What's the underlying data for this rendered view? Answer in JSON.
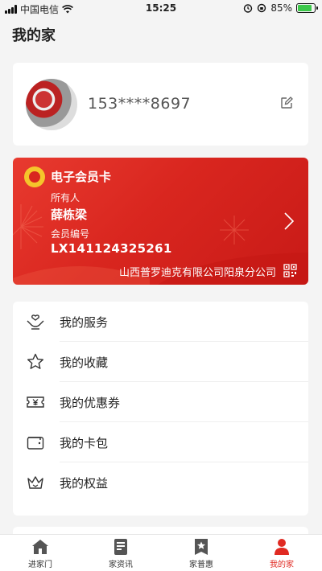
{
  "status_bar": {
    "carrier": "中国电信",
    "time": "15:25",
    "battery_percent": "85%",
    "battery_level": 0.85
  },
  "page": {
    "title": "我的家"
  },
  "profile": {
    "phone": "153****8697",
    "avatar_icon": "user-avatar-photo",
    "edit_icon": "edit-icon"
  },
  "member_card": {
    "title": "电子会员卡",
    "owner_label": "所有人",
    "owner_name": "薛栋梁",
    "number_label": "会员编号",
    "number": "LX141124325261",
    "company": "山西普罗迪克有限公司阳泉分公司",
    "card_color": "#d9261f",
    "logo_color": "#f5c52b"
  },
  "menu": {
    "items": [
      {
        "label": "我的服务",
        "icon": "service-hands-icon"
      },
      {
        "label": "我的收藏",
        "icon": "star-icon"
      },
      {
        "label": "我的优惠券",
        "icon": "coupon-icon"
      },
      {
        "label": "我的卡包",
        "icon": "wallet-icon"
      },
      {
        "label": "我的权益",
        "icon": "crown-icon"
      }
    ]
  },
  "tabbar": {
    "active_color": "#e02a22",
    "items": [
      {
        "label": "进家门",
        "icon": "home-icon"
      },
      {
        "label": "家资讯",
        "icon": "news-icon"
      },
      {
        "label": "家普惠",
        "icon": "benefit-star-icon"
      },
      {
        "label": "我的家",
        "icon": "person-icon",
        "active": true
      }
    ]
  }
}
